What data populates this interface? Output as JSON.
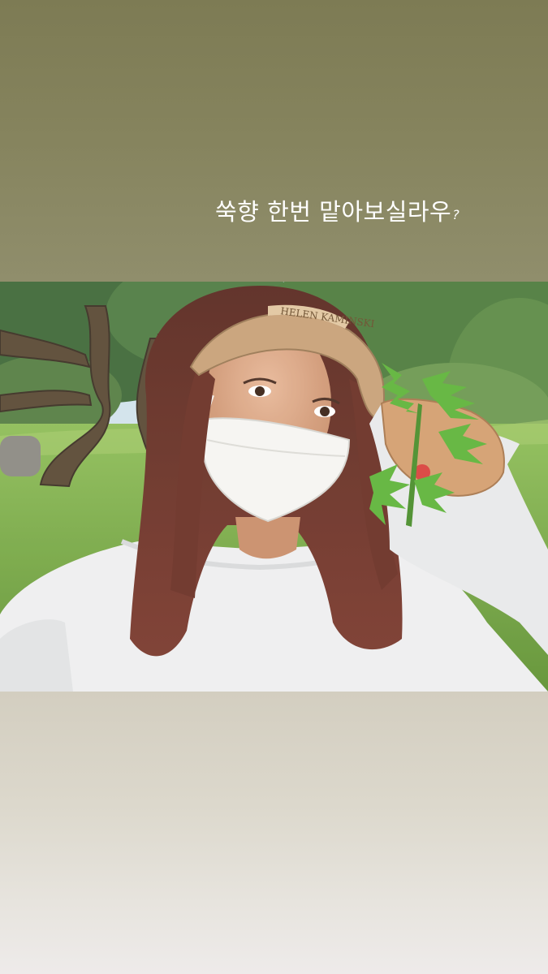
{
  "story": {
    "caption": "쑥향 한번 맡아보실라우",
    "caption_mark": "?",
    "visor_brand": "HELEN KAMINSKI",
    "colors": {
      "top_background": "#86845e",
      "bottom_background": "#e3dfd6",
      "caption_text": "#ffffff"
    }
  }
}
